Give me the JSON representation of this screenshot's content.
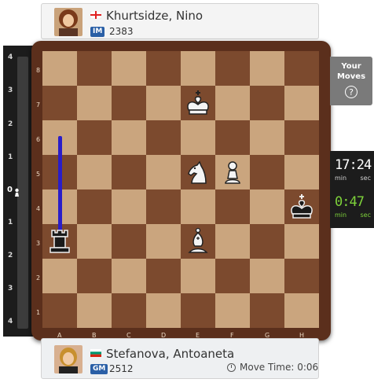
{
  "top_player": {
    "name": "Khurtsidze, Nino",
    "title": "IM",
    "rating": "2383",
    "flag": "georgia"
  },
  "bottom_player": {
    "name": "Stefanova, Antoaneta",
    "title": "GM",
    "rating": "2512",
    "flag": "bulgaria",
    "move_time": "Move Time: 0:06"
  },
  "eval_bar": {
    "labels_top": [
      "4",
      "3",
      "2",
      "1"
    ],
    "zero": "0",
    "labels_bottom": [
      "1",
      "2",
      "3",
      "4"
    ]
  },
  "board": {
    "ranks": [
      "8",
      "7",
      "6",
      "5",
      "4",
      "3",
      "2",
      "1"
    ],
    "files": [
      "A",
      "B",
      "C",
      "D",
      "E",
      "F",
      "G",
      "H"
    ],
    "pieces": [
      {
        "square": "e7",
        "piece": "white-king"
      },
      {
        "square": "e5",
        "piece": "white-knight"
      },
      {
        "square": "f5",
        "piece": "white-pawn"
      },
      {
        "square": "h4",
        "piece": "black-king"
      },
      {
        "square": "e3",
        "piece": "white-bishop"
      },
      {
        "square": "a3",
        "piece": "black-rook"
      }
    ],
    "arrow": {
      "from": "a3",
      "to": "a6",
      "color": "#2a1dc8"
    },
    "colors": {
      "light": "#caa57e",
      "dark": "#7c4a2e"
    }
  },
  "your_moves": {
    "label": "Your Moves",
    "icon": "help-icon"
  },
  "clocks": [
    {
      "time": "17:24",
      "min": "min",
      "sec": "sec",
      "color": "#ffffff"
    },
    {
      "time": "0:47",
      "min": "min",
      "sec": "sec",
      "color": "#7dd13a"
    }
  ]
}
